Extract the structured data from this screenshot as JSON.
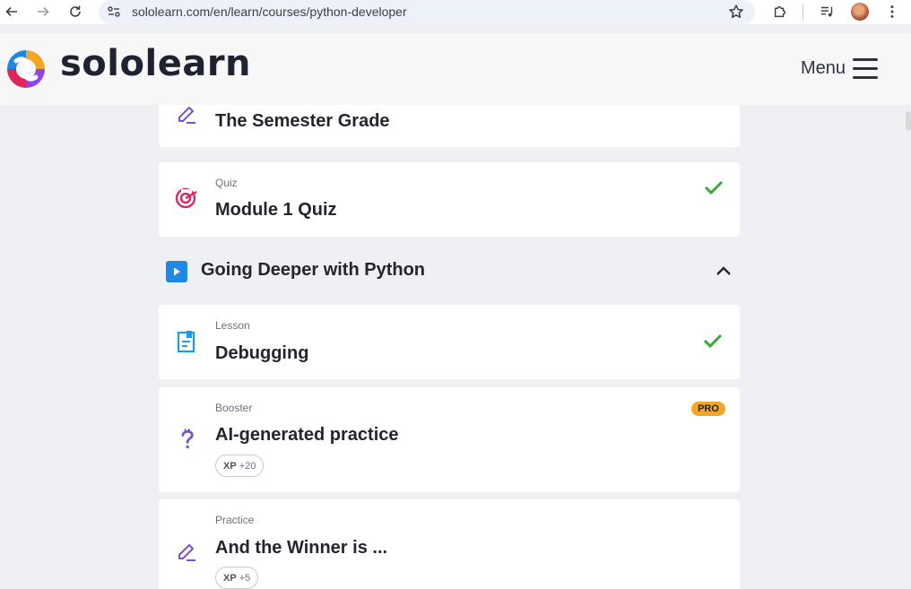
{
  "browser": {
    "url": "sololearn.com/en/learn/courses/python-developer"
  },
  "header": {
    "logo_text": "sololearn",
    "menu_label": "Menu"
  },
  "items": [
    {
      "title": "The Semester Grade",
      "icon": "practice-pencil-icon"
    },
    {
      "type": "Quiz",
      "title": "Module 1 Quiz",
      "icon": "quiz-target-icon",
      "completed": true
    },
    {
      "type": "Lesson",
      "title": "Debugging",
      "icon": "lesson-doc-icon",
      "completed": true
    },
    {
      "type": "Booster",
      "title": "AI-generated practice",
      "icon": "booster-question-icon",
      "badge": "PRO",
      "xp_label": "XP",
      "xp_value": "+20"
    },
    {
      "type": "Practice",
      "title": "And the Winner is ...",
      "icon": "practice-pencil-icon",
      "xp_label": "XP",
      "xp_value": "+5"
    }
  ],
  "module": {
    "title": "Going Deeper with Python",
    "expanded": true
  },
  "colors": {
    "accent_blue": "#1e88e5",
    "check_green": "#3aa935",
    "pro_orange": "#f5a623",
    "quiz_pink": "#e0245e",
    "practice_purple": "#7b4fd6"
  }
}
